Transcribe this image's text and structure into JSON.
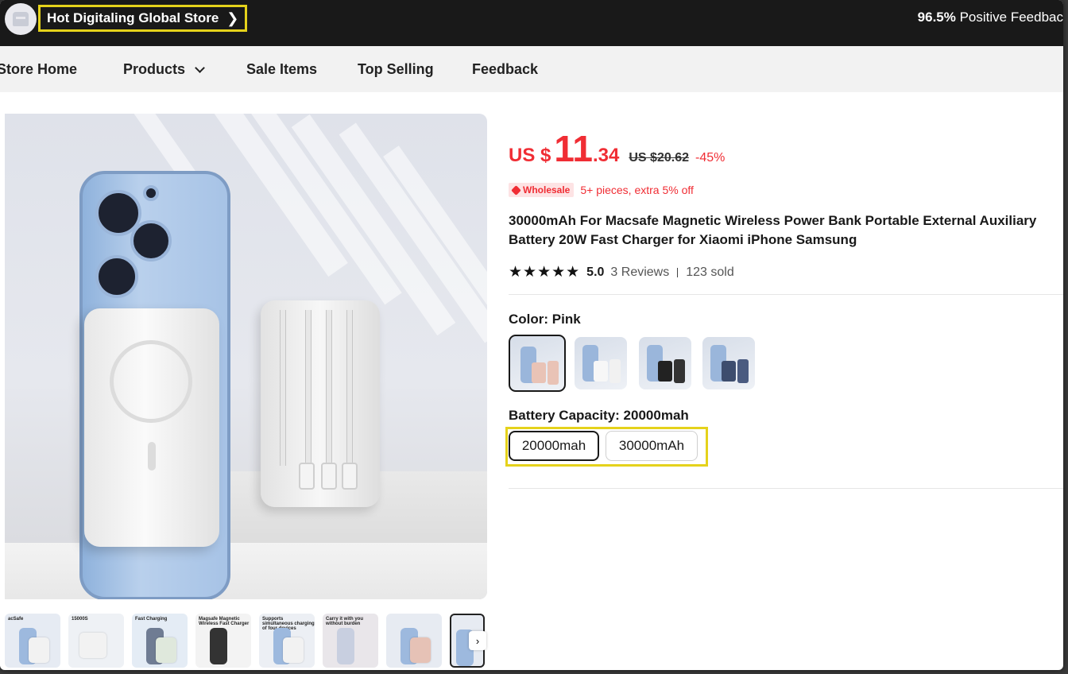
{
  "store": {
    "name": "Hot Digitaling Global Store",
    "positive_feedback_value": "96.5%",
    "positive_feedback_label": " Positive Feedbac"
  },
  "nav": {
    "store_home": "Store Home",
    "products": "Products",
    "sale_items": "Sale Items",
    "top_selling": "Top Selling",
    "feedback": "Feedback"
  },
  "product": {
    "price_currency": "US $",
    "price_integer": "11",
    "price_decimal": ".34",
    "original_price": "US $20.62",
    "discount": "-45%",
    "wholesale_tag": "Wholesale",
    "wholesale_text": "5+ pieces, extra 5% off",
    "title": "30000mAh For Macsafe Magnetic Wireless Power Bank Portable External Auxiliary Battery 20W Fast Charger for Xiaomi iPhone Samsung",
    "stars": "★★★★★",
    "rating": "5.0",
    "reviews": "3 Reviews",
    "sold": "123 sold"
  },
  "sku": {
    "color_label": "Color: Pink",
    "colors": [
      "Pink",
      "White",
      "Black",
      "Blue"
    ],
    "capacity_label": "Battery Capacity: 20000mah",
    "capacity_options": [
      "20000mah",
      "30000mAh"
    ],
    "selected_capacity": "20000mah"
  },
  "thumbnails": [
    {
      "caption": "acSafe"
    },
    {
      "caption": "15000S"
    },
    {
      "caption": "Fast Charging"
    },
    {
      "caption": "Magsafe Magnetic Wireless Fast Charger"
    },
    {
      "caption": "Supports simultaneous charging of four devices"
    },
    {
      "caption": "Carry it with you without burden"
    },
    {
      "caption": ""
    },
    {
      "caption": ""
    }
  ],
  "colors": {
    "accent_red": "#f02d34",
    "highlight_yellow": "#e5d21b",
    "topbar_bg": "#191919"
  }
}
